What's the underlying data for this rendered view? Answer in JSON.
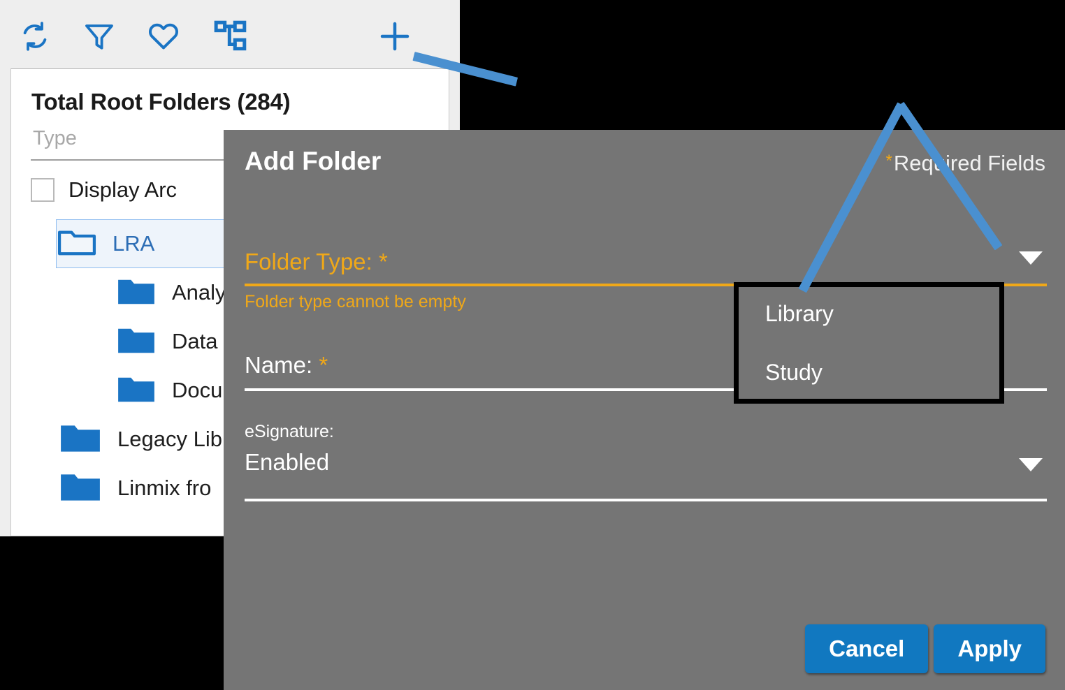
{
  "explorer": {
    "toolbar": {
      "icons": [
        {
          "name": "refresh-icon",
          "label": "Refresh"
        },
        {
          "name": "filter-icon",
          "label": "Filter"
        },
        {
          "name": "favorite-heart-icon",
          "label": "Favorites"
        },
        {
          "name": "hierarchy-icon",
          "label": "Hierarchy"
        },
        {
          "name": "add-plus-icon",
          "label": "Add"
        }
      ],
      "accent_color": "#1a74c4",
      "background_color": "#eeeeee"
    },
    "tree_title": "Total Root Folders (284)",
    "type_filter_placeholder": "Type",
    "type_filter_value": "",
    "display_archived_label": "Display Arc",
    "display_archived_checked": false,
    "tree_items": [
      {
        "label": "LRA",
        "depth": 1,
        "selected": true,
        "icon": "folder-open-outline-icon"
      },
      {
        "label": "Analy",
        "depth": 2,
        "selected": false,
        "icon": "folder-icon"
      },
      {
        "label": "Data",
        "depth": 2,
        "selected": false,
        "icon": "folder-icon"
      },
      {
        "label": "Docu",
        "depth": 2,
        "selected": false,
        "icon": "folder-icon"
      },
      {
        "label": "Legacy Lib",
        "depth": 1,
        "selected": false,
        "icon": "folder-icon"
      },
      {
        "label": "Linmix fro",
        "depth": 1,
        "selected": false,
        "icon": "folder-icon"
      }
    ]
  },
  "dialog": {
    "title": "Add Folder",
    "required_fields_note": "Required Fields",
    "required_marker": "*",
    "background_color": "#757575",
    "folder_type": {
      "label": "Folder Type:",
      "required_marker": "*",
      "value": "",
      "error": "Folder type cannot be empty",
      "error_color": "#f0a818",
      "caret": "chevron-down-icon"
    },
    "name": {
      "label": "Name:",
      "required_marker": "*",
      "value": ""
    },
    "esignature": {
      "label": "eSignature:",
      "value": "Enabled",
      "caret": "chevron-down-icon"
    },
    "dropdown": {
      "open": true,
      "options": [
        "Library",
        "Study"
      ],
      "border_color": "#000000"
    },
    "buttons": {
      "cancel": "Cancel",
      "apply": "Apply",
      "color": "#1178c0"
    }
  },
  "annotations": {
    "color": "#4a90d0",
    "arrows": [
      {
        "name": "arrow-to-add-button"
      },
      {
        "name": "arrow-peak-left"
      },
      {
        "name": "arrow-peak-right"
      }
    ]
  }
}
